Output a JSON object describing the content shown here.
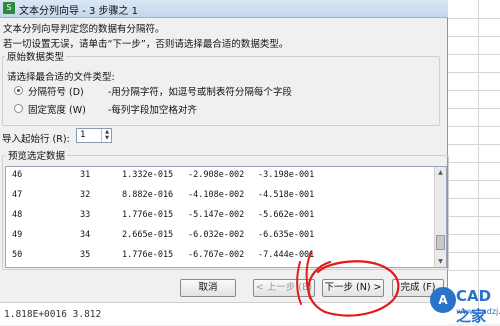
{
  "window": {
    "title": "文本分列向导 - 3 步骤之 1",
    "app_icon": "spreadsheet-app-icon"
  },
  "description": {
    "line1": "文本分列向导判定您的数据有分隔符。",
    "line2": "若一切设置无误，请单击“下一步”，否则请选择最合适的数据类型。"
  },
  "original_type": {
    "legend": "原始数据类型",
    "prompt": "请选择最合适的文件类型:",
    "options": [
      {
        "label": "分隔符号 (D)",
        "desc": "-用分隔字符，如逗号或制表符分隔每个字段",
        "selected": true
      },
      {
        "label": "固定宽度 (W)",
        "desc": "-每列字段加空格对齐",
        "selected": false
      }
    ]
  },
  "start_row": {
    "label": "导入起始行 (R):",
    "value": "1"
  },
  "preview": {
    "legend": "预览选定数据",
    "rows": [
      [
        "46",
        "31",
        "1.332e-015",
        "-2.908e-002",
        "-3.198e-001"
      ],
      [
        "47",
        "32",
        "8.882e-016",
        "-4.108e-002",
        "-4.518e-001"
      ],
      [
        "48",
        "33",
        "1.776e-015",
        "-5.147e-002",
        "-5.662e-001"
      ],
      [
        "49",
        "34",
        "2.665e-015",
        "-6.032e-002",
        "-6.635e-001"
      ],
      [
        "50",
        "35",
        "1.776e-015",
        "-6.767e-002",
        "-7.444e-001"
      ]
    ]
  },
  "buttons": {
    "cancel": "取消",
    "back": "< 上一步 (B)",
    "next": "下一步 (N) >",
    "finish": "完成 (F)"
  },
  "sheet_bottom": {
    "text": "1.818E+0016  3.812"
  },
  "watermark": {
    "logo": "A",
    "title": "CAD之家",
    "url": "www.cadzj.com"
  },
  "colors": {
    "annotation": "#e11a1a",
    "watermark": "#2a73c8",
    "radio_dot": "#1f4fa0"
  }
}
